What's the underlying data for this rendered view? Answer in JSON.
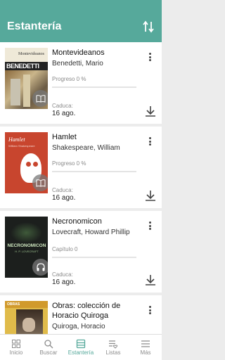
{
  "header": {
    "title": "Estantería"
  },
  "books": [
    {
      "title": "Montevideanos",
      "author": "Benedetti, Mario",
      "progress_label": "Progreso 0 %",
      "progress": 0,
      "expires_label": "Caduca:",
      "expires": "16 ago.",
      "format": "book",
      "cover_text": [
        "Montevideanos",
        "BENEDETTI"
      ]
    },
    {
      "title": "Hamlet",
      "author": "Shakespeare, William",
      "progress_label": "Progreso 0 %",
      "progress": 0,
      "expires_label": "Caduca:",
      "expires": "16 ago.",
      "format": "book",
      "cover_text": [
        "Hamlet",
        "William Shakespeare"
      ]
    },
    {
      "title": "Necronomicon",
      "author": "Lovecraft, Howard Phillip",
      "progress_label": "Capítulo 0",
      "progress": 0,
      "expires_label": "Caduca:",
      "expires": "16 ago.",
      "format": "audio",
      "cover_text": [
        "NECRONOMICON",
        "H. P. LOVECRAFT"
      ]
    },
    {
      "title": "Obras: colección de Horacio Quiroga",
      "author": "Quiroga, Horacio",
      "cover_text": [
        "OBRAS"
      ]
    }
  ],
  "nav": [
    {
      "label": "Inicio",
      "icon": "grid-icon"
    },
    {
      "label": "Buscar",
      "icon": "search-icon"
    },
    {
      "label": "Estantería",
      "icon": "shelf-icon",
      "active": true
    },
    {
      "label": "Listas",
      "icon": "list-heart-icon"
    },
    {
      "label": "Más",
      "icon": "menu-icon"
    }
  ],
  "colors": {
    "primary": "#56a99b",
    "background": "#ececec"
  }
}
